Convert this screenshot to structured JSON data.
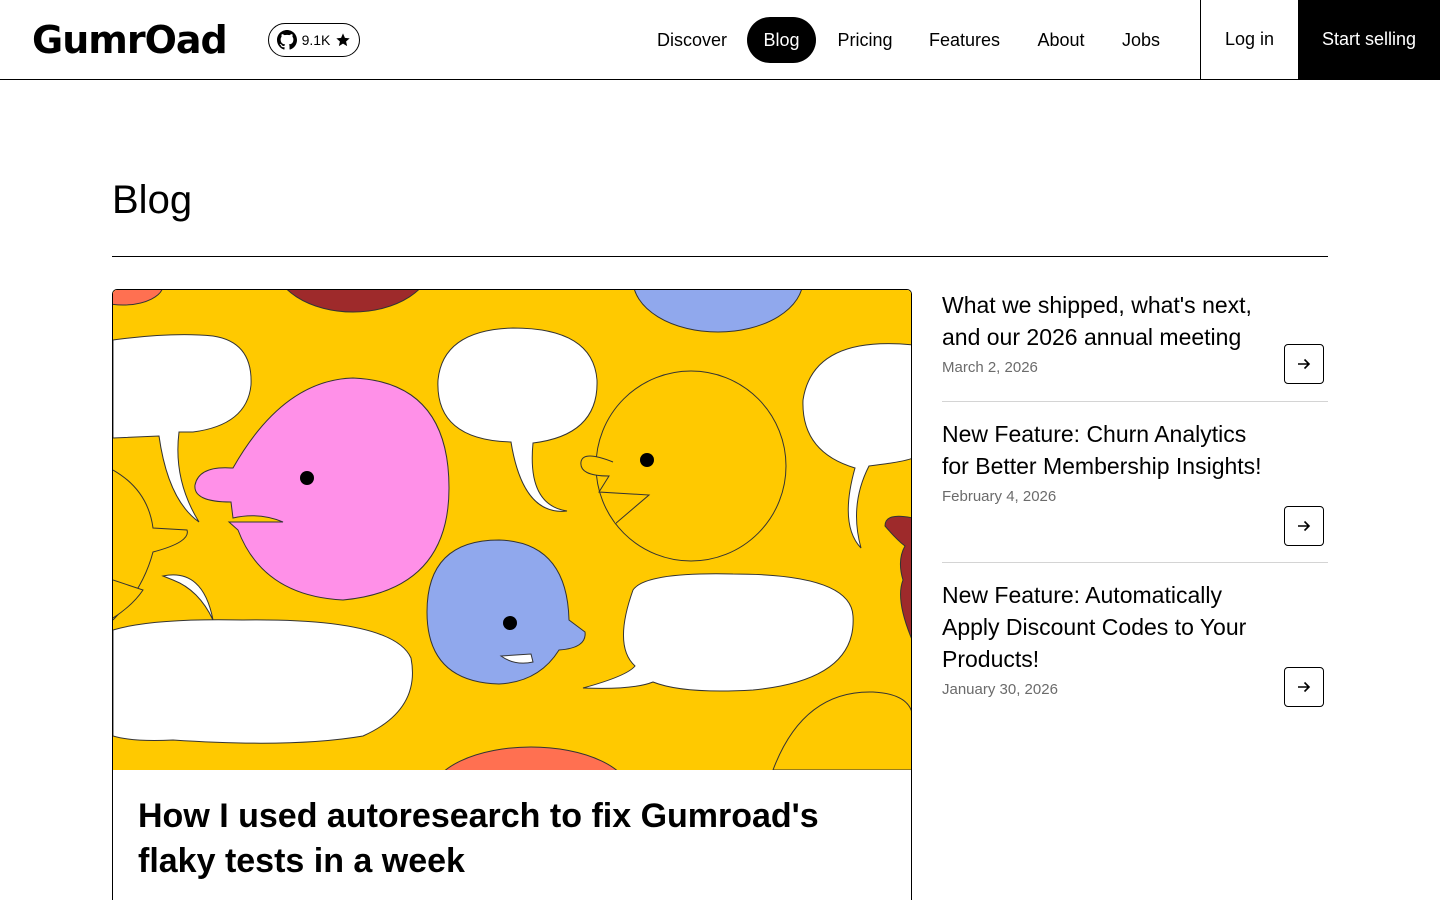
{
  "header": {
    "logo": "GumrOad",
    "github_stars": "9.1K",
    "nav": [
      {
        "label": "Discover",
        "active": false
      },
      {
        "label": "Blog",
        "active": true
      },
      {
        "label": "Pricing",
        "active": false
      },
      {
        "label": "Features",
        "active": false
      },
      {
        "label": "About",
        "active": false
      },
      {
        "label": "Jobs",
        "active": false
      }
    ],
    "login_label": "Log in",
    "start_selling_label": "Start selling"
  },
  "page": {
    "title": "Blog"
  },
  "featured_post": {
    "title": "How I used autoresearch to fix Gumroad's flaky tests in a week"
  },
  "posts": [
    {
      "title": "What we shipped, what's next, and our 2026 annual meeting",
      "date": "March 2, 2026"
    },
    {
      "title": "New Feature: Churn Analytics for Better Membership Insights!",
      "date": "February 4, 2026"
    },
    {
      "title": "New Feature: Automatically Apply Discount Codes to Your Products!",
      "date": "January 30, 2026"
    }
  ],
  "icons": {
    "github": "github-icon",
    "star": "star-icon",
    "arrow": "arrow-right-icon"
  },
  "colors": {
    "illustration_yellow": "#ffc900",
    "pink": "#ff90e8",
    "blue": "#90a8ed",
    "red": "#dc341e",
    "orange": "#ff7051",
    "date_gray": "#6b6b6b"
  }
}
